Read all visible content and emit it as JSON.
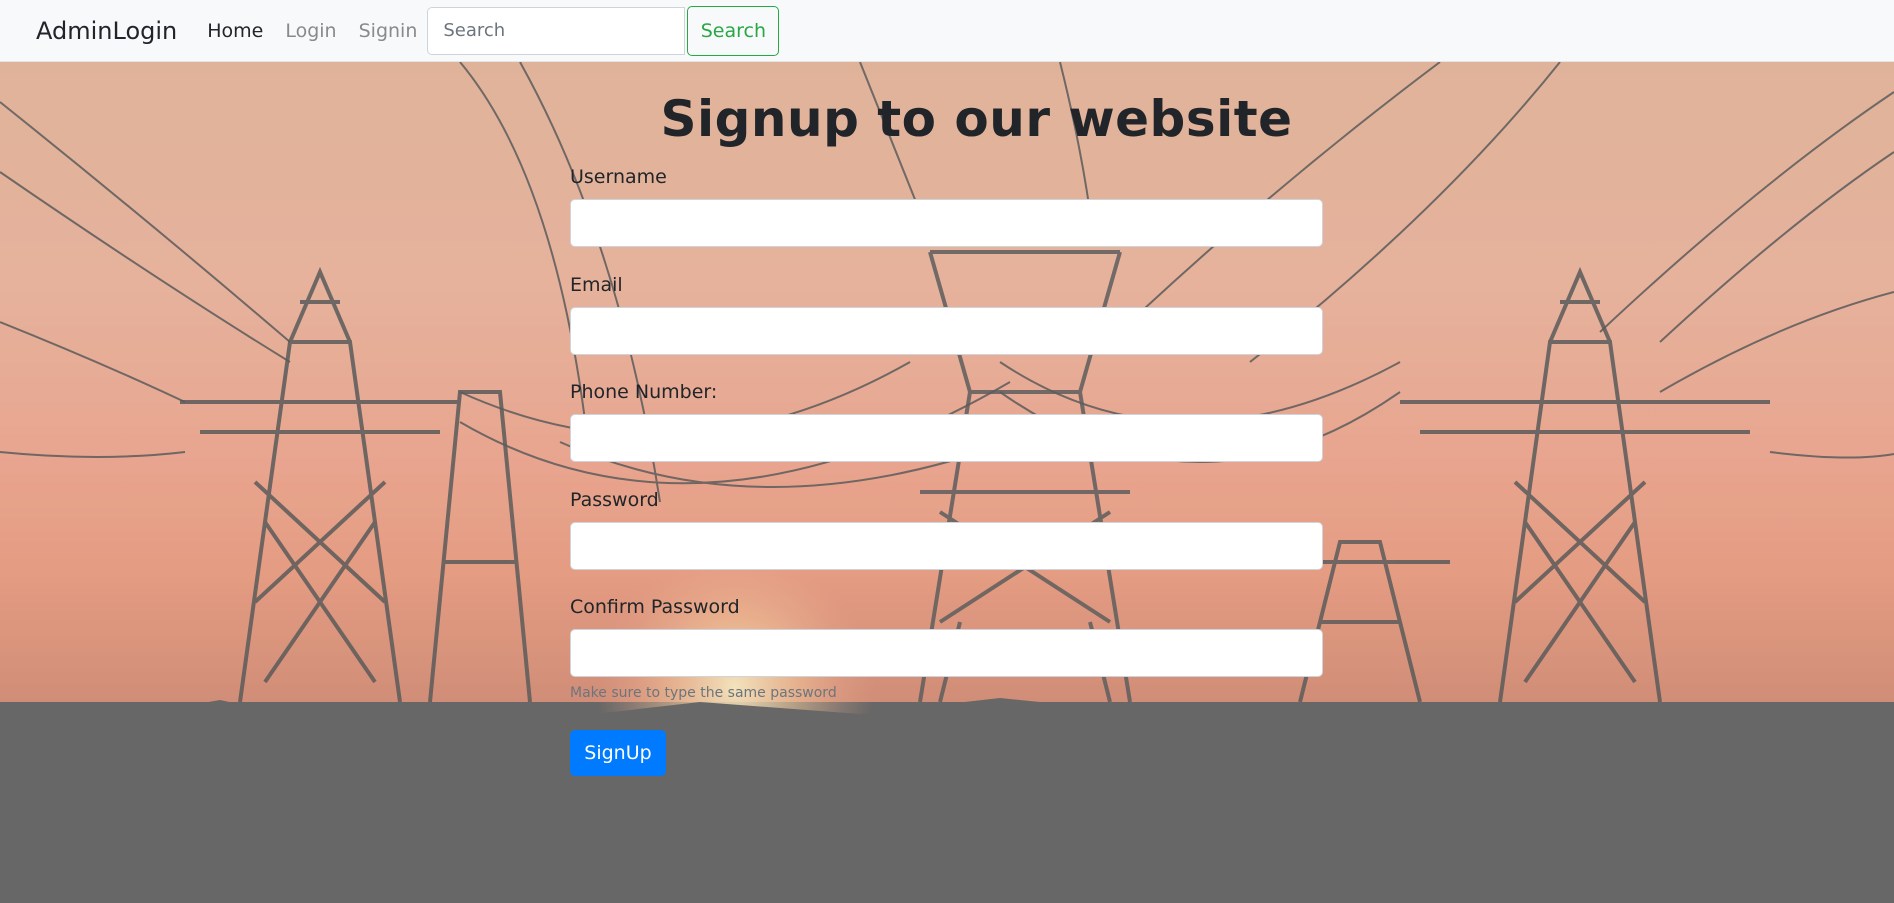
{
  "navbar": {
    "brand": "AdminLogin",
    "links": [
      {
        "label": "Home",
        "active": true
      },
      {
        "label": "Login",
        "active": false
      },
      {
        "label": "Signin",
        "active": false
      }
    ],
    "search": {
      "placeholder": "Search",
      "value": "",
      "button_label": "Search"
    }
  },
  "form": {
    "title": "Signup to our website",
    "fields": [
      {
        "label": "Username",
        "value": ""
      },
      {
        "label": "Email",
        "value": ""
      },
      {
        "label": "Phone Number:",
        "value": ""
      },
      {
        "label": "Password",
        "value": ""
      },
      {
        "label": "Confirm Password",
        "value": ""
      }
    ],
    "help_text": "Make sure to type the same password",
    "submit_label": "SignUp"
  },
  "colors": {
    "primary": "#007bff",
    "success": "#28a745",
    "navbar_bg": "#f8f9fa",
    "ground": "#666666"
  },
  "background": {
    "semantic": "power-lines-sunset-image"
  }
}
